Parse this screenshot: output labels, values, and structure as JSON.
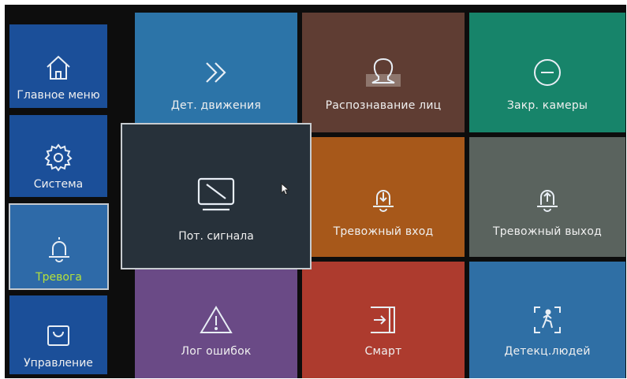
{
  "sidebar": {
    "items": [
      {
        "label": "Главное меню",
        "icon": "home-icon"
      },
      {
        "label": "Система",
        "icon": "gear-icon"
      },
      {
        "label": "Тревога",
        "icon": "bell-icon",
        "selected": true
      },
      {
        "label": "Управление",
        "icon": "bag-icon"
      }
    ]
  },
  "tiles": [
    {
      "label": "Дет. движения",
      "icon": "double-chevron-right-icon",
      "color": "#2c74a8"
    },
    {
      "label": "Распознавание лиц",
      "icon": "face-icon",
      "color": "#5f3d33"
    },
    {
      "label": "Закр. камеры",
      "icon": "minus-circle-icon",
      "color": "#17846a"
    },
    {
      "label": "Тревожный вход",
      "icon": "bell-down-icon",
      "color": "#a7581a"
    },
    {
      "label": "Тревожный выход",
      "icon": "bell-up-icon",
      "color": "#5a635e"
    },
    {
      "label": "Лог ошибок",
      "icon": "warning-icon",
      "color": "#6a4a86"
    },
    {
      "label": "Смарт",
      "icon": "login-icon",
      "color": "#ad3b2e"
    },
    {
      "label": "Детекц.людей",
      "icon": "person-detect-icon",
      "color": "#2f6fa5"
    }
  ],
  "popup": {
    "label": "Пот. сигнала",
    "icon": "video-loss-icon"
  },
  "colors": {
    "sidebar_bg": "#1b4f99",
    "sidebar_selected_bg": "#2e6aa8",
    "selected_label": "#b6e23a",
    "popup_bg": "#27313a"
  }
}
